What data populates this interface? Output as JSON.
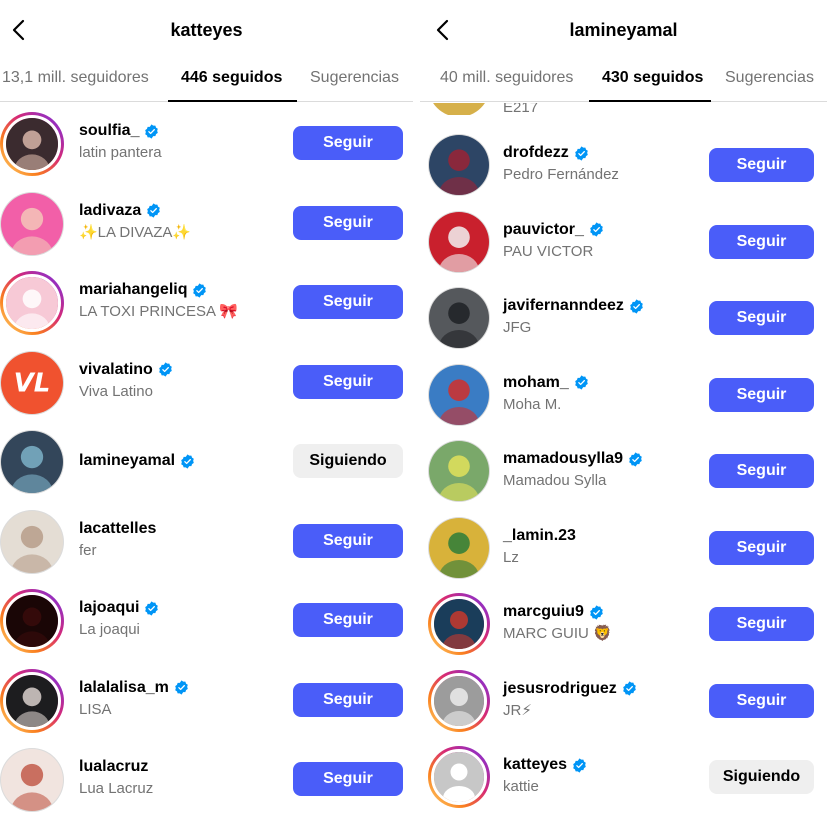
{
  "left": {
    "title": "katteyes",
    "tabs": [
      {
        "label": "13,1 mill. seguidores",
        "active": false
      },
      {
        "label": "446 seguidos",
        "active": true
      },
      {
        "label": "Sugerencias",
        "active": false
      }
    ],
    "users": [
      {
        "username": "soulfia_",
        "name": "latin pantera",
        "verified": true,
        "button": "Seguir",
        "following": false,
        "ring": true,
        "avatar_color": "#3b2b2f",
        "avatar_accent": "#d8b5a8"
      },
      {
        "username": "ladivaza",
        "name": "✨LA DIVAZA✨",
        "verified": true,
        "button": "Seguir",
        "following": false,
        "ring": false,
        "avatar_color": "#f25fa8",
        "avatar_accent": "#f4c6b8"
      },
      {
        "username": "mariahangeliq",
        "name": "LA TOXI PRINCESA 🎀",
        "verified": true,
        "button": "Seguir",
        "following": false,
        "ring": true,
        "avatar_color": "#f7c9d6",
        "avatar_accent": "#ffffff"
      },
      {
        "username": "vivalatino",
        "name": "Viva Latino",
        "verified": true,
        "button": "Seguir",
        "following": false,
        "ring": false,
        "avatar_color": "#f0522f",
        "avatar_accent": "#ffffff",
        "avatar_text": "VL"
      },
      {
        "username": "lamineyamal",
        "name": "",
        "verified": true,
        "button": "Siguiendo",
        "following": true,
        "ring": false,
        "avatar_color": "#33465a",
        "avatar_accent": "#7db1c8"
      },
      {
        "username": "lacattelles",
        "name": "fer",
        "verified": false,
        "button": "Seguir",
        "following": false,
        "ring": false,
        "avatar_color": "#e4ddd4",
        "avatar_accent": "#b79e8a"
      },
      {
        "username": "lajoaqui",
        "name": "La joaqui",
        "verified": true,
        "button": "Seguir",
        "following": false,
        "ring": true,
        "avatar_color": "#1a0606",
        "avatar_accent": "#3a0c0c"
      },
      {
        "username": "lalalalisa_m",
        "name": "LISA",
        "verified": true,
        "button": "Seguir",
        "following": false,
        "ring": true,
        "avatar_color": "#1d1d1f",
        "avatar_accent": "#d9d0cc"
      },
      {
        "username": "lualacruz",
        "name": "Lua Lacruz",
        "verified": false,
        "button": "Seguir",
        "following": false,
        "ring": false,
        "avatar_color": "#f1e4df",
        "avatar_accent": "#c25a4a"
      }
    ]
  },
  "right": {
    "title": "lamineyamal",
    "tabs": [
      {
        "label": "40 mill. seguidores",
        "active": false
      },
      {
        "label": "430 seguidos",
        "active": true
      },
      {
        "label": "Sugerencias",
        "active": false
      }
    ],
    "partial_top_name": "E217",
    "users": [
      {
        "username": "drofdezz",
        "name": "Pedro Fernández",
        "verified": true,
        "button": "Seguir",
        "following": false,
        "ring": false,
        "avatar_color": "#2d4565",
        "avatar_accent": "#9b2335"
      },
      {
        "username": "pauvictor_",
        "name": "PAU VICTOR",
        "verified": true,
        "button": "Seguir",
        "following": false,
        "ring": false,
        "avatar_color": "#c9202d",
        "avatar_accent": "#f2f2f2"
      },
      {
        "username": "javifernanndeez",
        "name": "JFG",
        "verified": true,
        "button": "Seguir",
        "following": false,
        "ring": false,
        "avatar_color": "#55585c",
        "avatar_accent": "#1f2124"
      },
      {
        "username": "moham_",
        "name": "Moha M.",
        "verified": true,
        "button": "Seguir",
        "following": false,
        "ring": false,
        "avatar_color": "#3a7cc4",
        "avatar_accent": "#d22f2a"
      },
      {
        "username": "mamadousylla9",
        "name": "Mamadou Sylla",
        "verified": true,
        "button": "Seguir",
        "following": false,
        "ring": false,
        "avatar_color": "#7aa86a",
        "avatar_accent": "#e2e25a"
      },
      {
        "username": "_lamin.23",
        "name": "Lz",
        "verified": false,
        "button": "Seguir",
        "following": false,
        "ring": false,
        "avatar_color": "#d8b23a",
        "avatar_accent": "#2d7c3a"
      },
      {
        "username": "marcguiu9",
        "name": "MARC GUIU 🦁",
        "verified": true,
        "button": "Seguir",
        "following": false,
        "ring": true,
        "avatar_color": "#1a3d5a",
        "avatar_accent": "#c8382d"
      },
      {
        "username": "jesusrodriguez",
        "name": "JR⚡",
        "verified": true,
        "button": "Seguir",
        "following": false,
        "ring": true,
        "avatar_color": "#9c9c9c",
        "avatar_accent": "#ececec"
      },
      {
        "username": "katteyes",
        "name": "kattie",
        "verified": true,
        "button": "Siguiendo",
        "following": true,
        "ring": true,
        "avatar_color": "#c7c7c7",
        "avatar_accent": "#ffffff",
        "default_avatar": true
      }
    ]
  },
  "colors": {
    "follow_button": "#4a5df9",
    "following_button": "#efefef",
    "verified_badge": "#0095f6",
    "secondary_text": "#737373"
  },
  "icons": {
    "back": "chevron-left-icon",
    "verified": "verified-badge-icon"
  }
}
